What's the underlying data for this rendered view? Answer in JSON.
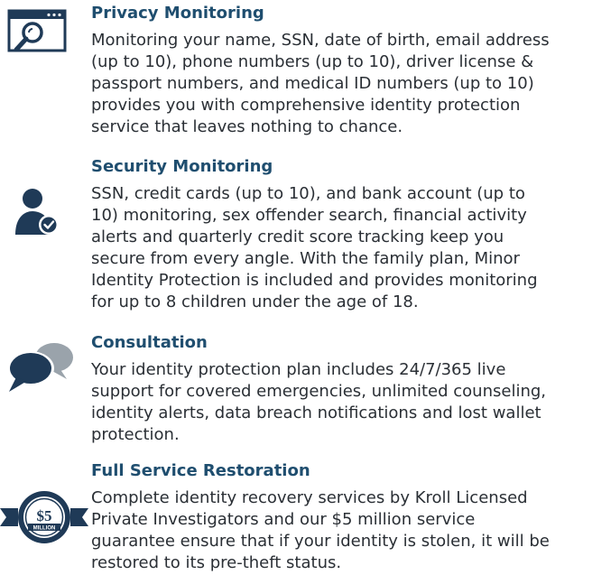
{
  "sections": [
    {
      "title": "Privacy Monitoring",
      "icon": "monitor-search-icon",
      "lines": [
        "Monitoring your name, SSN, date of birth, email address",
        "(up to 10), phone numbers (up to 10), driver license &",
        "passport numbers, and medical ID numbers (up to 10)",
        "provides you with comprehensive identity protection",
        "service that leaves nothing to chance."
      ]
    },
    {
      "title": "Security Monitoring",
      "icon": "user-check-icon",
      "lines": [
        "SSN, credit cards (up to 10), and bank account (up to",
        "10) monitoring, sex offender search, financial activity",
        "alerts and quarterly credit score tracking keep you",
        "secure from every angle. With the family plan, Minor",
        "Identity Protection is included and provides monitoring",
        "for up to 8 children under the age of 18."
      ]
    },
    {
      "title": "Consultation",
      "icon": "chat-bubbles-icon",
      "lines": [
        "Your identity protection plan includes 24/7/365 live",
        "support for covered emergencies, unlimited counseling,",
        "identity alerts, data breach notifications and lost wallet",
        "protection."
      ]
    },
    {
      "title": "Full Service Restoration",
      "icon": "million-badge-icon",
      "badge": {
        "amount": "$5",
        "label": "MILLION"
      },
      "lines": [
        "Complete identity recovery services by Kroll Licensed",
        "Private Investigators and our $5 million service",
        "guarantee ensure that if your identity is stolen, it will be",
        "restored to its pre-theft status."
      ]
    }
  ],
  "colors": {
    "title": "#1f4e6f",
    "text": "#2a2f35",
    "icon": "#1f3a57",
    "chat_secondary": "#9aa3ab"
  }
}
